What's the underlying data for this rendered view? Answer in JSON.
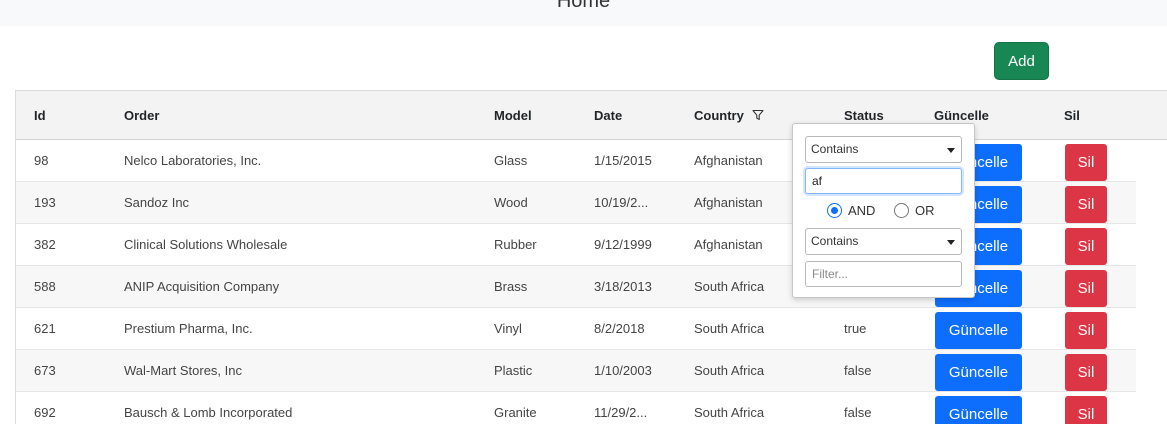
{
  "header": {
    "title": "Home"
  },
  "toolbar": {
    "add_label": "Add"
  },
  "table": {
    "columns": [
      "Id",
      "Order",
      "Model",
      "Date",
      "Country",
      "Status",
      "Güncelle",
      "Sil"
    ],
    "rows": [
      {
        "id": "98",
        "order": "Nelco Laboratories, Inc.",
        "model": "Glass",
        "date": "1/15/2015",
        "country": "Afghanistan",
        "status": "",
        "update": "Güncelle",
        "delete": "Sil"
      },
      {
        "id": "193",
        "order": "Sandoz Inc",
        "model": "Wood",
        "date": "10/19/2...",
        "country": "Afghanistan",
        "status": "",
        "update": "Güncelle",
        "delete": "Sil"
      },
      {
        "id": "382",
        "order": "Clinical Solutions Wholesale",
        "model": "Rubber",
        "date": "9/12/1999",
        "country": "Afghanistan",
        "status": "",
        "update": "Güncelle",
        "delete": "Sil"
      },
      {
        "id": "588",
        "order": "ANIP Acquisition Company",
        "model": "Brass",
        "date": "3/18/2013",
        "country": "South Africa",
        "status": "",
        "update": "Güncelle",
        "delete": "Sil"
      },
      {
        "id": "621",
        "order": "Prestium Pharma, Inc.",
        "model": "Vinyl",
        "date": "8/2/2018",
        "country": "South Africa",
        "status": "true",
        "update": "Güncelle",
        "delete": "Sil"
      },
      {
        "id": "673",
        "order": "Wal-Mart Stores, Inc",
        "model": "Plastic",
        "date": "1/10/2003",
        "country": "South Africa",
        "status": "false",
        "update": "Güncelle",
        "delete": "Sil"
      },
      {
        "id": "692",
        "order": "Bausch & Lomb Incorporated",
        "model": "Granite",
        "date": "11/29/2...",
        "country": "South Africa",
        "status": "false",
        "update": "Güncelle",
        "delete": "Sil"
      }
    ]
  },
  "filter": {
    "operator1": "Contains",
    "value1": "af",
    "logic": {
      "and_label": "AND",
      "or_label": "OR",
      "selected": "AND"
    },
    "operator2": "Contains",
    "value2": "",
    "value2_placeholder": "Filter..."
  },
  "icons": {
    "filter": "filter-icon",
    "caret": "chevron-down-icon"
  },
  "colors": {
    "add": "#198754",
    "update": "#0d6efd",
    "delete": "#dc3545",
    "header_bg": "#f3f3f3"
  }
}
